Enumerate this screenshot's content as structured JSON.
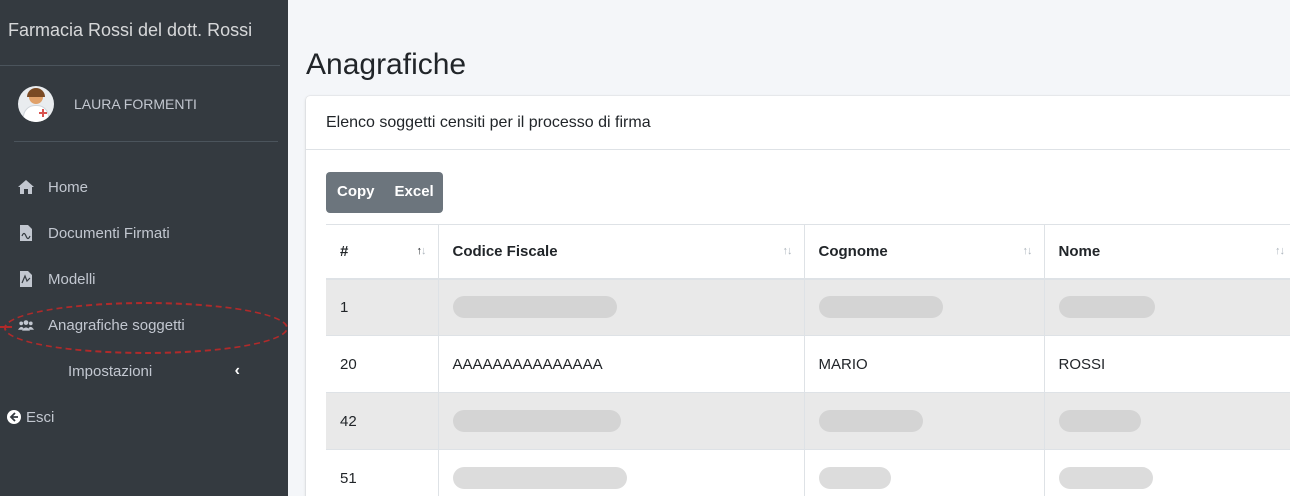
{
  "brand": {
    "title": "Farmacia Rossi del dott. Rossi"
  },
  "user": {
    "name": "LAURA FORMENTI"
  },
  "nav": {
    "home": "Home",
    "documenti": "Documenti Firmati",
    "modelli": "Modelli",
    "anagrafiche": "Anagrafiche soggetti",
    "impostazioni": "Impostazioni",
    "esci": "Esci"
  },
  "page": {
    "title": "Anagrafiche"
  },
  "card": {
    "header": "Elenco soggetti censiti per il processo di firma"
  },
  "buttons": {
    "copy": "Copy",
    "excel": "Excel"
  },
  "table": {
    "columns": [
      "#",
      "Codice Fiscale",
      "Cognome",
      "Nome"
    ],
    "rows": [
      {
        "id": "1",
        "codice_fiscale": "",
        "cognome": "",
        "nome": ""
      },
      {
        "id": "20",
        "codice_fiscale": "AAAAAAAAAAAAAAA",
        "cognome": "MARIO",
        "nome": "ROSSI"
      },
      {
        "id": "42",
        "codice_fiscale": "",
        "cognome": "",
        "nome": ""
      },
      {
        "id": "51",
        "codice_fiscale": "",
        "cognome": "",
        "nome": ""
      }
    ]
  },
  "icons": {
    "home": "home-icon",
    "documenti": "file-pdf-icon",
    "modelli": "file-pdf-icon",
    "anagrafiche": "users-icon",
    "impostazioni_chevron": "chevron-left-icon",
    "esci": "arrow-circle-left-icon"
  },
  "colors": {
    "sidebar_bg": "#343a40",
    "sidebar_text": "#c2c7d0",
    "button_bg": "#6c757d",
    "annotation": "#b02a2a"
  }
}
